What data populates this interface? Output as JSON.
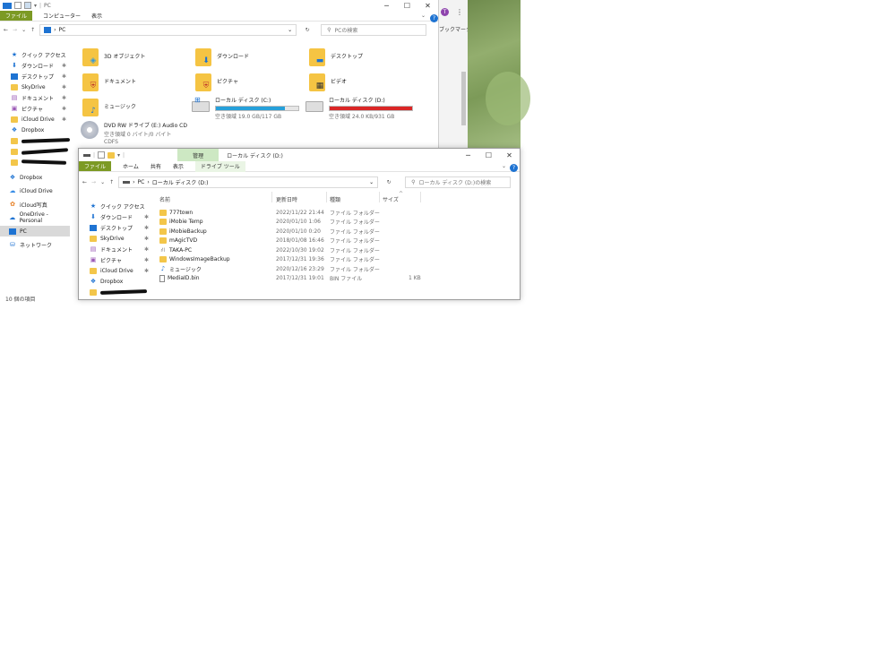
{
  "window1": {
    "title": "PC",
    "ribbon_tabs": [
      "ファイル",
      "コンピューター",
      "表示"
    ],
    "address": "PC",
    "search_placeholder": "PCの検索",
    "nav_items": [
      {
        "label": "クイック アクセス",
        "icon": "star-icon",
        "pinned": false
      },
      {
        "label": "ダウンロード",
        "icon": "download-icon",
        "pinned": true
      },
      {
        "label": "デスクトップ",
        "icon": "desktop-icon",
        "pinned": true
      },
      {
        "label": "SkyDrive",
        "icon": "folder-icon",
        "pinned": true
      },
      {
        "label": "ドキュメント",
        "icon": "document-icon",
        "pinned": true
      },
      {
        "label": "ピクチャ",
        "icon": "picture-icon",
        "pinned": true
      },
      {
        "label": "iCloud Drive",
        "icon": "folder-icon",
        "pinned": true
      },
      {
        "label": "Dropbox",
        "icon": "dropbox-icon",
        "pinned": false
      }
    ],
    "nav_items_lower": [
      {
        "label": "Dropbox",
        "icon": "dropbox-icon"
      },
      {
        "label": "iCloud Drive",
        "icon": "icloud-icon"
      },
      {
        "label": "iCloud写真",
        "icon": "icloud-photo-icon"
      },
      {
        "label": "OneDrive - Personal",
        "icon": "onedrive-icon"
      },
      {
        "label": "PC",
        "icon": "pc-icon",
        "selected": true
      },
      {
        "label": "ネットワーク",
        "icon": "network-icon"
      }
    ],
    "status_count": "10 個の項目",
    "tiles": {
      "objects3d": "3D オブジェクト",
      "downloads": "ダウンロード",
      "desktop": "デスクトップ",
      "documents": "ドキュメント",
      "pictures": "ピクチャ",
      "videos": "ビデオ",
      "music": "ミュージック",
      "drive_c": {
        "name": "ローカル ディスク (C:)",
        "free": "空き領域 19.0 GB/117 GB",
        "used_fraction": 0.84,
        "color": "#26a0da"
      },
      "drive_d": {
        "name": "ローカル ディスク (D:)",
        "free": "空き領域 24.0 KB/931 GB",
        "used_fraction": 1.0,
        "color": "#da2626"
      },
      "dvd": {
        "name": "DVD RW ドライブ (E:) Audio CD",
        "free": "空き領域 0 バイト/0 バイト",
        "fs": "CDFS"
      }
    }
  },
  "browser_fragment": {
    "bookmark_text": "ブックマーク",
    "avatar_letter": "T"
  },
  "window2": {
    "title": "ローカル ディスク (D:)",
    "manage_tab": "管理",
    "ribbon_tabs": [
      "ファイル",
      "ホーム",
      "共有",
      "表示"
    ],
    "drive_tools_tab": "ドライブ ツール",
    "breadcrumb": [
      "PC",
      "ローカル ディスク (D:)"
    ],
    "search_placeholder": "ローカル ディスク (D:)の検索",
    "columns": {
      "name": "名前",
      "modified": "更新日時",
      "type": "種類",
      "size": "サイズ"
    },
    "nav_items": [
      {
        "label": "クイック アクセス",
        "icon": "star-icon",
        "pinned": false
      },
      {
        "label": "ダウンロード",
        "icon": "download-icon",
        "pinned": true
      },
      {
        "label": "デスクトップ",
        "icon": "desktop-icon",
        "pinned": true
      },
      {
        "label": "SkyDrive",
        "icon": "folder-icon",
        "pinned": true
      },
      {
        "label": "ドキュメント",
        "icon": "document-icon",
        "pinned": true
      },
      {
        "label": "ピクチャ",
        "icon": "picture-icon",
        "pinned": true
      },
      {
        "label": "iCloud Drive",
        "icon": "folder-icon",
        "pinned": true
      },
      {
        "label": "Dropbox",
        "icon": "dropbox-icon",
        "pinned": false
      }
    ],
    "files": [
      {
        "name": "777town",
        "modified": "2022/11/22 21:44",
        "type": "ファイル フォルダー",
        "size": "",
        "icon": "folder-icon"
      },
      {
        "name": "iMobie Temp",
        "modified": "2020/01/10 1:06",
        "type": "ファイル フォルダー",
        "size": "",
        "icon": "folder-icon"
      },
      {
        "name": "iMobieBackup",
        "modified": "2020/01/10 0:20",
        "type": "ファイル フォルダー",
        "size": "",
        "icon": "folder-icon"
      },
      {
        "name": "mAgicTVD",
        "modified": "2018/01/08 16:46",
        "type": "ファイル フォルダー",
        "size": "",
        "icon": "folder-icon"
      },
      {
        "name": "TAKA-PC",
        "modified": "2022/10/30 19:02",
        "type": "ファイル フォルダー",
        "size": "",
        "icon": "network-folder-icon"
      },
      {
        "name": "WindowsImageBackup",
        "modified": "2017/12/31 19:36",
        "type": "ファイル フォルダー",
        "size": "",
        "icon": "folder-icon"
      },
      {
        "name": "ミュージック",
        "modified": "2020/12/16 23:29",
        "type": "ファイル フォルダー",
        "size": "",
        "icon": "music-icon"
      },
      {
        "name": "MediaID.bin",
        "modified": "2017/12/31 19:01",
        "type": "BIN ファイル",
        "size": "1 KB",
        "icon": "file-icon"
      }
    ]
  }
}
